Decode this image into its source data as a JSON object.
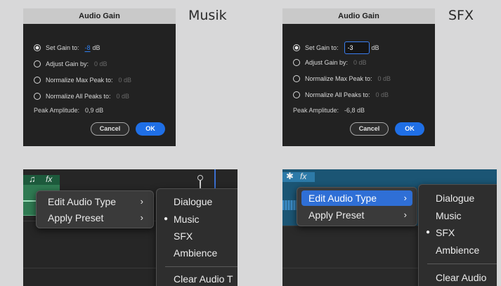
{
  "labels": {
    "left": "Musik",
    "right": "SFX"
  },
  "dialog_left": {
    "title": "Audio Gain",
    "options": [
      {
        "label": "Set Gain to:",
        "value": "-8",
        "unit": "dB"
      },
      {
        "label": "Adjust Gain by:",
        "value": "0 dB"
      },
      {
        "label": "Normalize Max Peak to:",
        "value": "0 dB"
      },
      {
        "label": "Normalize All Peaks to:",
        "value": "0 dB"
      }
    ],
    "peak_label": "Peak Amplitude:",
    "peak_value": "0,9 dB",
    "cancel": "Cancel",
    "ok": "OK"
  },
  "dialog_right": {
    "title": "Audio Gain",
    "options": [
      {
        "label": "Set Gain to:",
        "value": "-3",
        "unit": "dB"
      },
      {
        "label": "Adjust Gain by:",
        "value": "0 dB"
      },
      {
        "label": "Normalize Max Peak to:",
        "value": "0 dB"
      },
      {
        "label": "Normalize All Peaks to:",
        "value": "0 dB"
      }
    ],
    "peak_label": "Peak Amplitude:",
    "peak_value": "-6,8 dB",
    "cancel": "Cancel",
    "ok": "OK"
  },
  "menu_left": {
    "clip_fx": "fx",
    "clip_note": "♫",
    "items": [
      {
        "label": "Edit Audio Type",
        "arrow": "›"
      },
      {
        "label": "Apply Preset",
        "arrow": "›"
      }
    ],
    "submenu": [
      {
        "label": "Dialogue"
      },
      {
        "label": "Music",
        "bullet": "●"
      },
      {
        "label": "SFX"
      },
      {
        "label": "Ambience"
      }
    ],
    "clear": "Clear Audio T"
  },
  "menu_right": {
    "clip_fx": "fx",
    "clip_star": "✱",
    "items": [
      {
        "label": "Edit Audio Type",
        "arrow": "›"
      },
      {
        "label": "Apply Preset",
        "arrow": "›"
      }
    ],
    "submenu": [
      {
        "label": "Dialogue"
      },
      {
        "label": "Music"
      },
      {
        "label": "SFX",
        "bullet": "●"
      },
      {
        "label": "Ambience"
      }
    ],
    "clear": "Clear Audio"
  },
  "colors": {
    "accent": "#1f6fe6",
    "dialog_bg": "#222222",
    "menu_highlight": "#2f6fd6"
  }
}
